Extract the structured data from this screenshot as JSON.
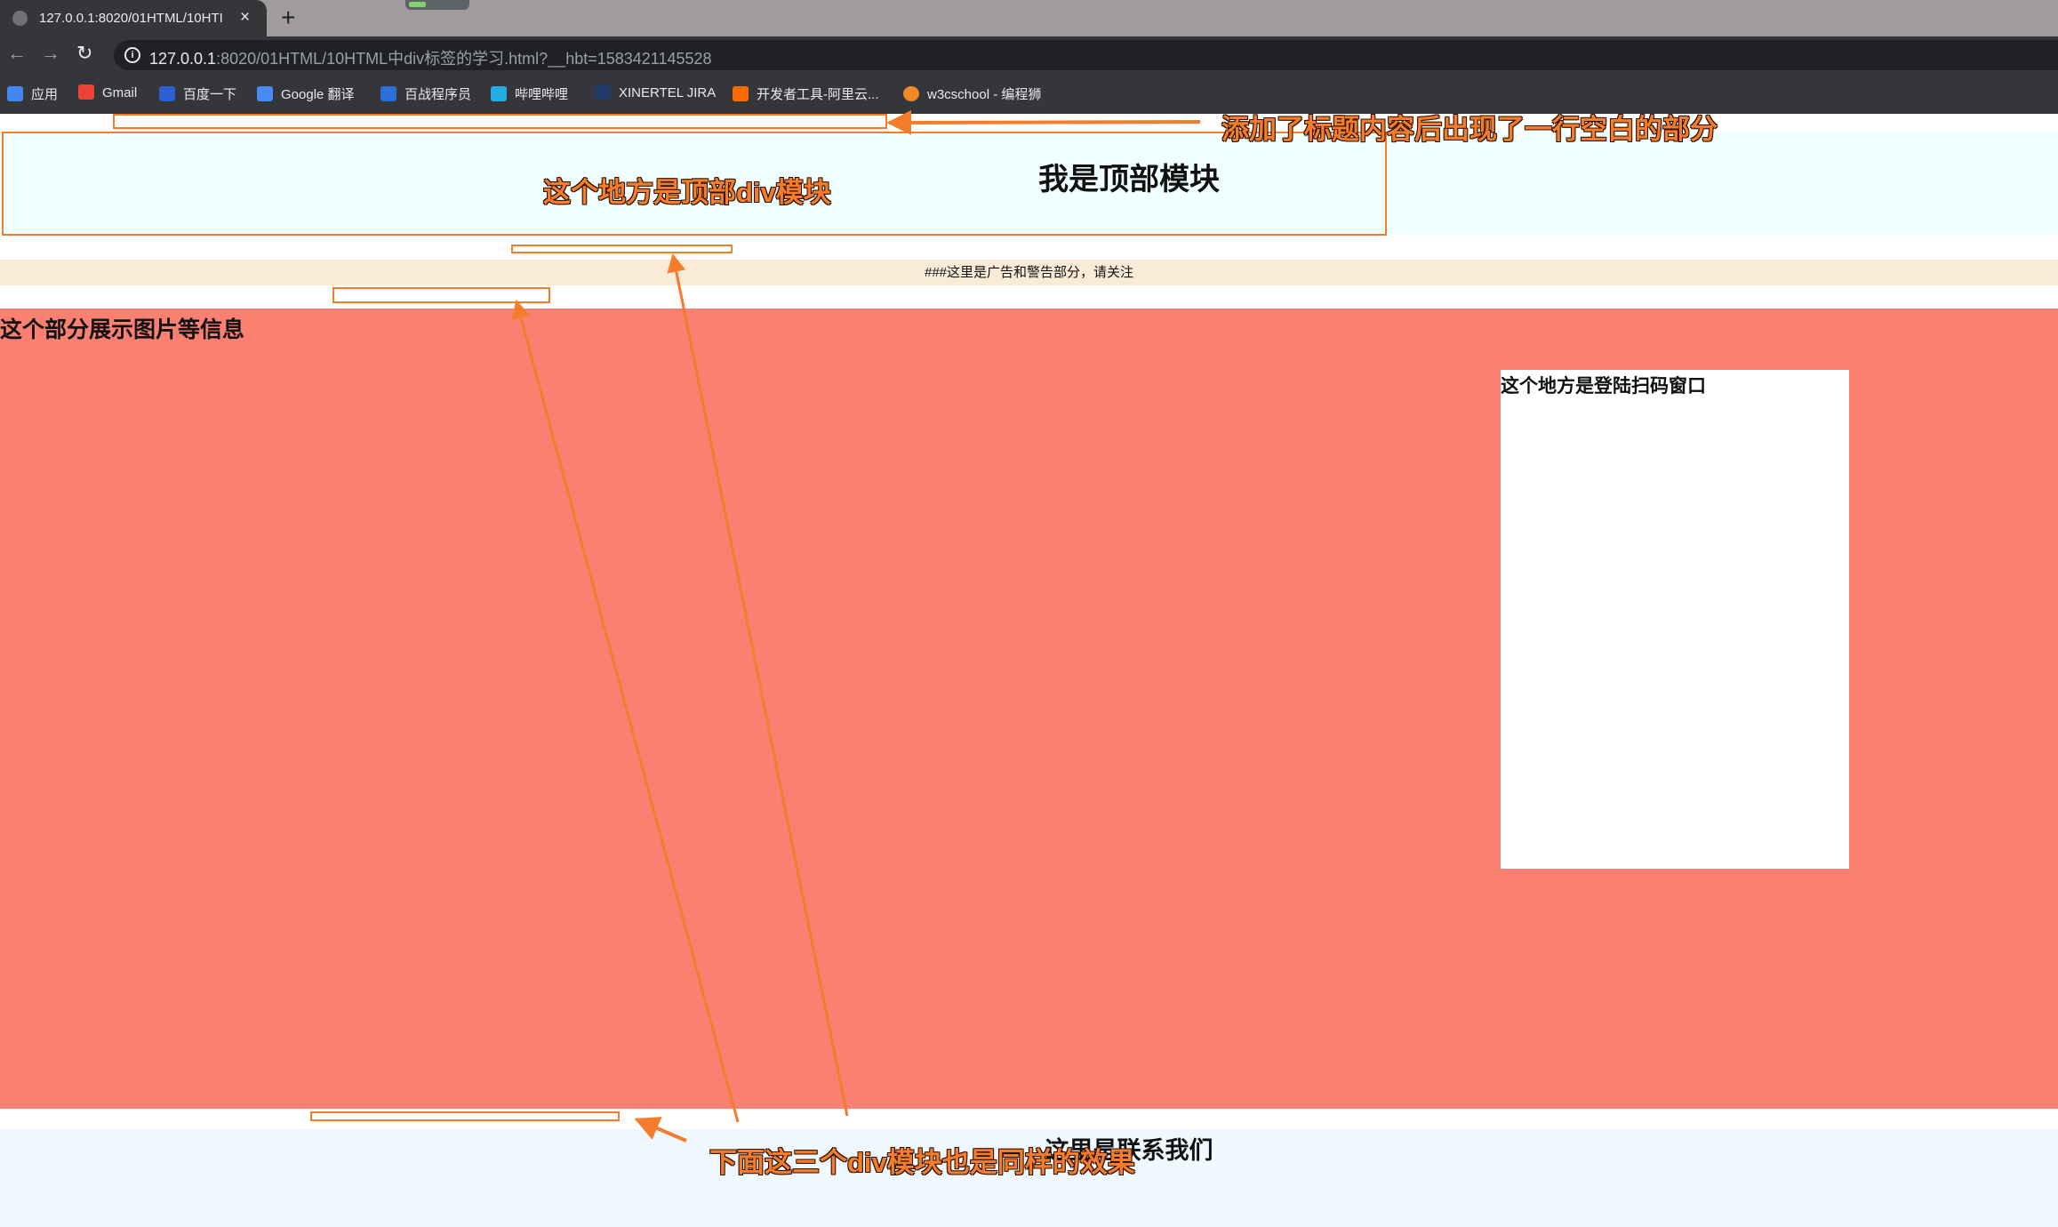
{
  "browser": {
    "tab": {
      "title": "127.0.0.1:8020/01HTML/10HTML中div标签的学习.html?__hbt=1583421145528",
      "short_title": "127.0.0.1:8020/01HTML/10HTI"
    },
    "new_tab": "+",
    "load_progress": 0.3,
    "url_host": "127.0.0.1",
    "url_rest": ":8020/01HTML/10HTML中div标签的学习.html?__hbt=1583421145528",
    "bookmarks": [
      {
        "label": "应用",
        "icon": "apps-icon"
      },
      {
        "label": "Gmail",
        "icon": "gmail-icon"
      },
      {
        "label": "百度一下",
        "icon": "baidu-icon"
      },
      {
        "label": "Google 翻译",
        "icon": "google-translate-icon"
      },
      {
        "label": "百战程序员",
        "icon": "bz-icon"
      },
      {
        "label": "哔哩哔哩",
        "icon": "bilibili-icon"
      },
      {
        "label": "XINERTEL JIRA",
        "icon": "jira-icon"
      },
      {
        "label": "开发者工具-阿里云...",
        "icon": "aliyun-icon"
      },
      {
        "label": "w3cschool - 编程狮",
        "icon": "w3cschool-icon"
      }
    ]
  },
  "page": {
    "top_heading": "我是顶部模块",
    "ad_text": "###这里是广告和警告部分，请关注",
    "main_heading": "这个部分展示图片等信息",
    "login_heading": "这个地方是登陆扫码窗口",
    "footer_heading": "这里是联系我们"
  },
  "annotations": {
    "blank_line_note": "添加了标题内容后出现了一行空白的部分",
    "top_div_note": "这个地方是顶部div模块",
    "three_divs_note": "下面这三个div模块也是同样的效果"
  },
  "colors": {
    "annotation": "#f47c2b",
    "top_module_bg": "#f0ffff",
    "ad_bg": "#faebd7",
    "main_bg": "#fa8072",
    "footer_bg": "#f0f8ff"
  }
}
